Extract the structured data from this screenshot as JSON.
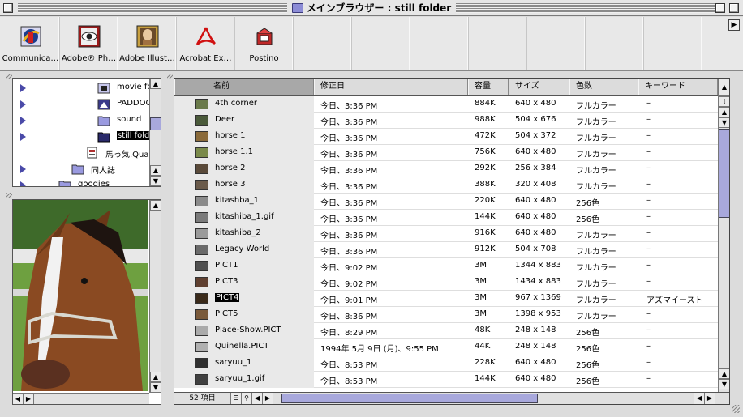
{
  "window": {
    "title": "メインブラウザー : still folder"
  },
  "launcher": {
    "items": [
      {
        "label": "Communica…",
        "icon": "communicator-icon"
      },
      {
        "label": "Adobe® Ph…",
        "icon": "photoshop-eye-icon"
      },
      {
        "label": "Adobe Illust…",
        "icon": "illustrator-icon"
      },
      {
        "label": "Acrobat Ex…",
        "icon": "acrobat-icon"
      },
      {
        "label": "Postino",
        "icon": "postino-mail-icon"
      }
    ]
  },
  "tree": {
    "items": [
      {
        "label": "movie fo",
        "expanded": false
      },
      {
        "label": "PADDOCK",
        "expanded": false
      },
      {
        "label": "sound",
        "expanded": false
      },
      {
        "label": "still fold",
        "expanded": false,
        "selected": true
      },
      {
        "label": "馬っ気.Quar",
        "expanded": false
      },
      {
        "label": "同人誌",
        "expanded": false
      },
      {
        "label": "goodies",
        "expanded": false
      }
    ]
  },
  "preview": {
    "icon": "horse-photo-preview"
  },
  "list": {
    "columns": [
      "名前",
      "修正日",
      "容量",
      "サイズ",
      "色数",
      "キーワード"
    ],
    "sorted_column": "名前",
    "rows": [
      [
        "4th corner",
        "今日、3:36 PM",
        "884K",
        "640 x 480",
        "フルカラー",
        "–"
      ],
      [
        "Deer",
        "今日、3:36 PM",
        "988K",
        "504 x 676",
        "フルカラー",
        "–"
      ],
      [
        "horse 1",
        "今日、3:36 PM",
        "472K",
        "504 x 372",
        "フルカラー",
        "–"
      ],
      [
        "horse 1.1",
        "今日、3:36 PM",
        "756K",
        "640 x 480",
        "フルカラー",
        "–"
      ],
      [
        "horse 2",
        "今日、3:36 PM",
        "292K",
        "256 x 384",
        "フルカラー",
        "–"
      ],
      [
        "horse 3",
        "今日、3:36 PM",
        "388K",
        "320 x 408",
        "フルカラー",
        "–"
      ],
      [
        "kitashba_1",
        "今日、3:36 PM",
        "220K",
        "640 x 480",
        "256色",
        "–"
      ],
      [
        "kitashiba_1.gif",
        "今日、3:36 PM",
        "144K",
        "640 x 480",
        "256色",
        "–"
      ],
      [
        "kitashiba_2",
        "今日、3:36 PM",
        "916K",
        "640 x 480",
        "フルカラー",
        "–"
      ],
      [
        "Legacy World",
        "今日、3:36 PM",
        "912K",
        "504 x 708",
        "フルカラー",
        "–"
      ],
      [
        "PICT1",
        "今日、9:02 PM",
        "3M",
        "1344 x 883",
        "フルカラー",
        "–"
      ],
      [
        "PICT3",
        "今日、9:02 PM",
        "3M",
        "1434 x 883",
        "フルカラー",
        "–"
      ],
      [
        "PICT4",
        "今日、9:01 PM",
        "3M",
        "967 x 1369",
        "フルカラー",
        "アズマイースト"
      ],
      [
        "PICT5",
        "今日、8:36 PM",
        "3M",
        "1398 x 953",
        "フルカラー",
        "–"
      ],
      [
        "Place-Show.PICT",
        "今日、8:29 PM",
        "48K",
        "248 x 148",
        "256色",
        "–"
      ],
      [
        "Quinella.PICT",
        "1994年 5月 9日 (月)、9:55 PM",
        "44K",
        "248 x 148",
        "256色",
        "–"
      ],
      [
        "saryuu_1",
        "今日、8:53 PM",
        "228K",
        "640 x 480",
        "256色",
        "–"
      ],
      [
        "saryuu_1.gif",
        "今日、8:53 PM",
        "144K",
        "640 x 480",
        "256色",
        "–"
      ]
    ],
    "selected_row": "PICT4",
    "item_count": "52 項目"
  },
  "colors": {
    "accent": "#a8a8dc",
    "selection": "#000000",
    "window_bg": "#dcdcdc"
  }
}
